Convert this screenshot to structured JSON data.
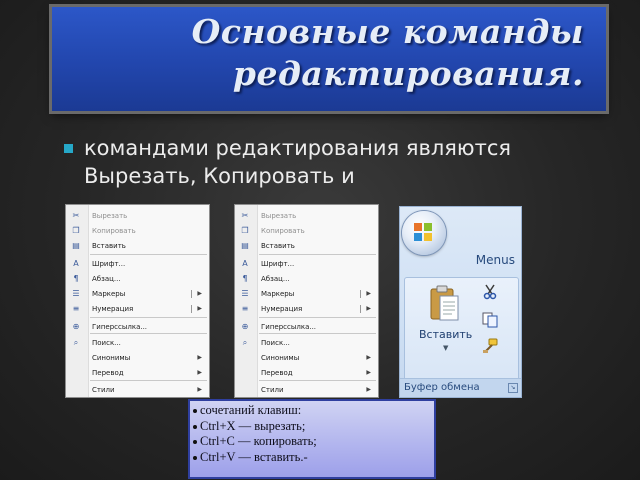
{
  "slide": {
    "title": "Основные команды редактирования.",
    "bullet_text": "командами редактирования являются Вырезать, Копировать и"
  },
  "context_menu": {
    "items": [
      {
        "icon": "scissors-icon",
        "label": "Вырезать",
        "disabled": true
      },
      {
        "icon": "copy-icon",
        "label": "Копировать",
        "disabled": true
      },
      {
        "icon": "paste-icon",
        "label": "Вставить",
        "disabled": false
      },
      {
        "icon": "font-icon",
        "label": "Шрифт...",
        "disabled": false
      },
      {
        "icon": "paragraph-icon",
        "label": "Абзац...",
        "disabled": false
      },
      {
        "icon": "bullets-icon",
        "label": "Маркеры",
        "disabled": false,
        "submenu": true,
        "split": true
      },
      {
        "icon": "numbering-icon",
        "label": "Нумерация",
        "disabled": false,
        "submenu": true,
        "split": true
      },
      {
        "icon": "hyperlink-icon",
        "label": "Гиперссылка...",
        "disabled": false
      },
      {
        "icon": "search-icon",
        "label": "Поиск...",
        "disabled": false
      },
      {
        "icon": "",
        "label": "Синонимы",
        "disabled": false,
        "submenu": true
      },
      {
        "icon": "",
        "label": "Перевод",
        "disabled": false,
        "submenu": true
      },
      {
        "icon": "",
        "label": "Стили",
        "disabled": false,
        "submenu": true
      }
    ]
  },
  "clipboard_ribbon": {
    "menus_label": "Menus",
    "paste_label": "Вставить",
    "group_label": "Буфер обмена"
  },
  "shortcuts_note": {
    "lines": [
      "сочетаний клавиш:",
      "Ctrl+X — вырезать;",
      "Ctrl+C — копировать;",
      "Ctrl+V — вставить.-"
    ]
  },
  "colors": {
    "title_bg": "#2246ad",
    "bullet_accent": "#26a8c8",
    "note_border": "#2f3f9f"
  }
}
